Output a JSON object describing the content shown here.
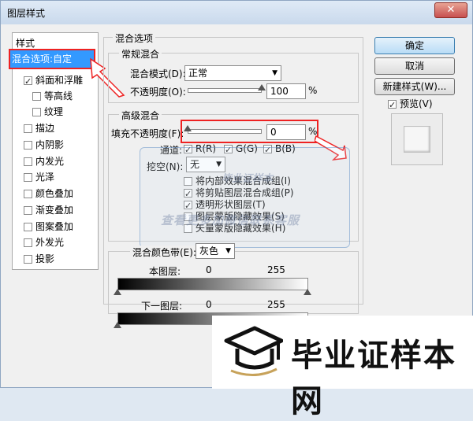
{
  "window": {
    "title": "图层样式",
    "close": "✕"
  },
  "sidebar": {
    "heading": "样式",
    "selected": "混合选项:自定",
    "items": [
      {
        "label": "斜面和浮雕",
        "checked": true
      },
      {
        "label": "等高线",
        "checked": false
      },
      {
        "label": "纹理",
        "checked": false
      },
      {
        "label": "描边",
        "checked": false
      },
      {
        "label": "内阴影",
        "checked": false
      },
      {
        "label": "内发光",
        "checked": false
      },
      {
        "label": "光泽",
        "checked": false
      },
      {
        "label": "颜色叠加",
        "checked": false
      },
      {
        "label": "渐变叠加",
        "checked": false
      },
      {
        "label": "图案叠加",
        "checked": false
      },
      {
        "label": "外发光",
        "checked": false
      },
      {
        "label": "投影",
        "checked": false
      }
    ]
  },
  "blend": {
    "section_title": "混合选项",
    "general": {
      "title": "常规混合",
      "mode_label": "混合模式(D):",
      "mode_value": "正常",
      "opacity_label": "不透明度(O):",
      "opacity_value": "100",
      "percent": "%"
    },
    "advanced": {
      "title": "高级混合",
      "fill_label": "填充不透明度(F):",
      "fill_value": "0",
      "percent": "%",
      "channels_label": "通道:",
      "channel_r": "R(R)",
      "channel_g": "G(G)",
      "channel_b": "B(B)",
      "knockout_label": "挖空(N):",
      "knockout_value": "无",
      "options": [
        {
          "label": "将内部效果混合成组(I)",
          "checked": false
        },
        {
          "label": "将剪贴图层混合成组(P)",
          "checked": true
        },
        {
          "label": "透明形状图层(T)",
          "checked": true
        },
        {
          "label": "图层蒙版隐藏效果(S)",
          "checked": false
        },
        {
          "label": "矢量蒙版隐藏效果(H)",
          "checked": false
        }
      ]
    },
    "blendif": {
      "label": "混合颜色带(E):",
      "value": "灰色",
      "this_layer": "本图层:",
      "this_min": "0",
      "this_max": "255",
      "under_layer": "下一图层:",
      "under_min": "0",
      "under_max": "255"
    }
  },
  "buttons": {
    "ok": "确定",
    "cancel": "取消",
    "new_style": "新建样式(W)...",
    "preview_label": "预览(V)"
  },
  "watermark": {
    "top": "毕业证样本",
    "middle": "查看更多加微信联系客服",
    "banner": "毕业证样本网"
  }
}
